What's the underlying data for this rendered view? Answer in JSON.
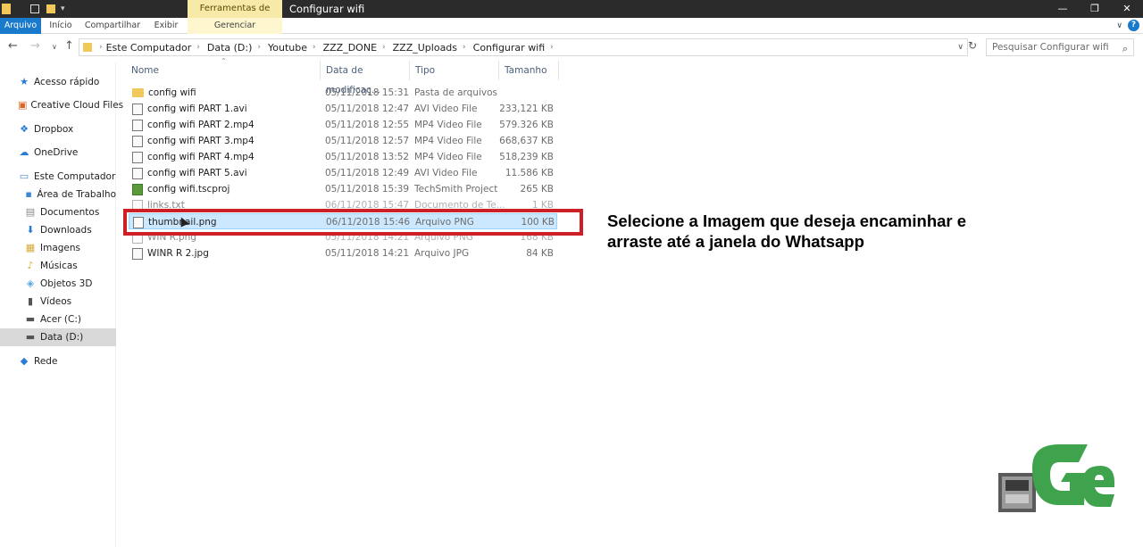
{
  "titlebar": {
    "context_tab": "Ferramentas de Imagem",
    "window_title": "Configurar wifi",
    "controls": [
      "—",
      "❐",
      "✕"
    ]
  },
  "ribbon": {
    "tabs": [
      "Arquivo",
      "Início",
      "Compartilhar",
      "Exibir",
      "Gerenciar"
    ]
  },
  "address": {
    "crumbs": [
      "Este Computador",
      "Data (D:)",
      "Youtube",
      "ZZZ_DONE",
      "ZZZ_Uploads",
      "Configurar wifi"
    ],
    "search_placeholder": "Pesquisar Configurar wifi"
  },
  "nav": {
    "items": [
      "Acesso rápido",
      "Creative Cloud Files",
      "Dropbox",
      "OneDrive",
      "Este Computador",
      "Área de Trabalho",
      "Documentos",
      "Downloads",
      "Imagens",
      "Músicas",
      "Objetos 3D",
      "Vídeos",
      "Acer (C:)",
      "Data (D:)",
      "Rede"
    ]
  },
  "columns": [
    "Nome",
    "Data de modificaç...",
    "Tipo",
    "Tamanho"
  ],
  "files": [
    {
      "name": "config wifi",
      "date": "05/11/2018 15:31",
      "type": "Pasta de arquivos",
      "size": ""
    },
    {
      "name": "config wifi PART 1.avi",
      "date": "05/11/2018 12:47",
      "type": "AVI Video File",
      "size": "233,121 KB"
    },
    {
      "name": "config wifi PART 2.mp4",
      "date": "05/11/2018 12:55",
      "type": "MP4 Video File",
      "size": "579.326 KB"
    },
    {
      "name": "config wifi PART 3.mp4",
      "date": "05/11/2018 12:57",
      "type": "MP4 Video File",
      "size": "668,637 KB"
    },
    {
      "name": "config wifi PART 4.mp4",
      "date": "05/11/2018 13:52",
      "type": "MP4 Video File",
      "size": "518,239 KB"
    },
    {
      "name": "config wifi PART 5.avi",
      "date": "05/11/2018 12:49",
      "type": "AVI Video File",
      "size": "11.586 KB"
    },
    {
      "name": "config wifi.tscproj",
      "date": "05/11/2018 15:39",
      "type": "TechSmith Project",
      "size": "265 KB"
    },
    {
      "name": "links.txt",
      "date": "06/11/2018 15:47",
      "type": "Documento de Te...",
      "size": "1 KB"
    },
    {
      "name": "thumbnail.png",
      "date": "06/11/2018 15:46",
      "type": "Arquivo PNG",
      "size": "100 KB"
    },
    {
      "name": "WIN R.png",
      "date": "05/11/2018 14:21",
      "type": "Arquivo PNG",
      "size": "168 KB"
    },
    {
      "name": "WINR R 2.jpg",
      "date": "05/11/2018 14:21",
      "type": "Arquivo JPG",
      "size": "84 KB"
    }
  ],
  "annotation": "Selecione a Imagem que deseja encaminhar e arraste até a janela do Whatsapp",
  "colors": {
    "accent": "#1979ca",
    "highlight": "#cc1f26",
    "selection": "#cce8ff"
  }
}
